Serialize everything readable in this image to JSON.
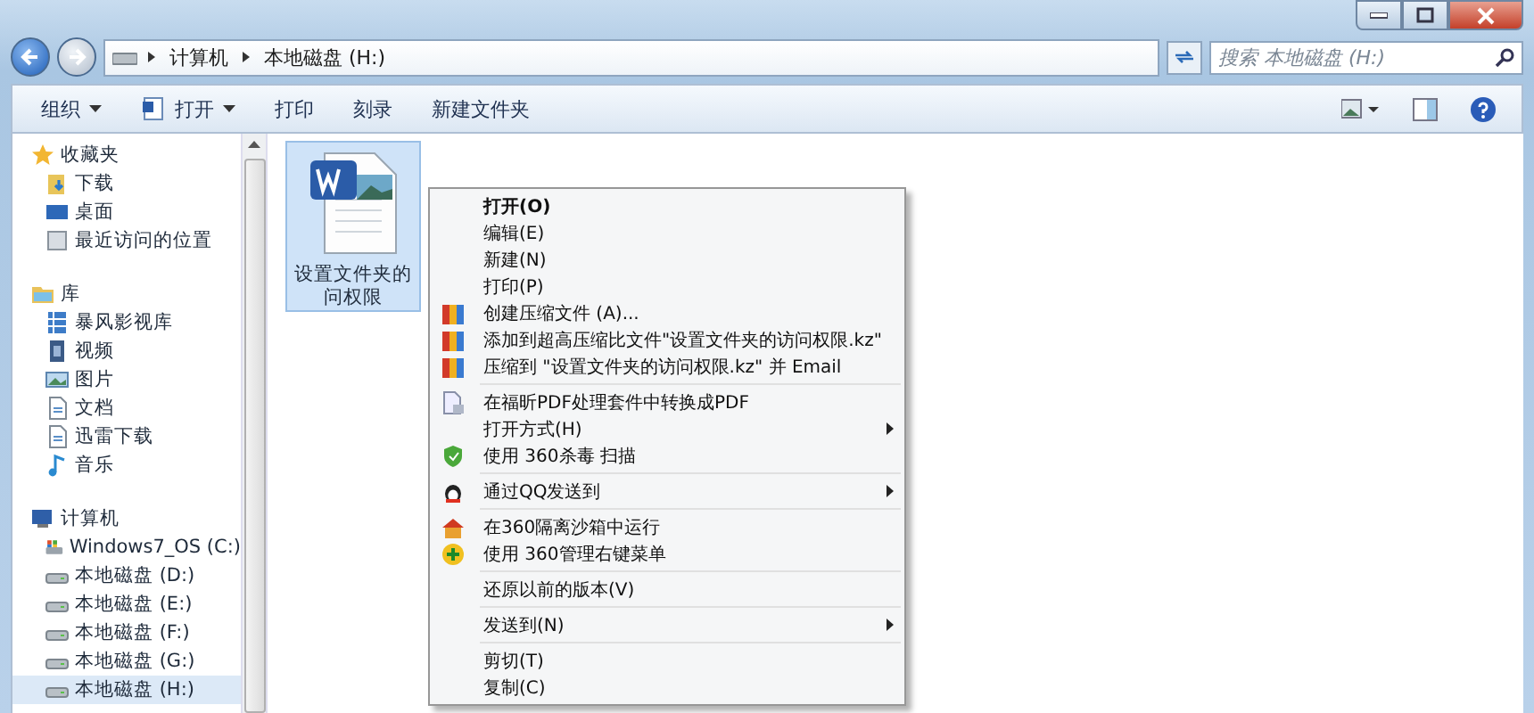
{
  "address_bar": {
    "breadcrumb": [
      "计算机",
      "本地磁盘 (H:)"
    ]
  },
  "search": {
    "placeholder": "搜索 本地磁盘 (H:)"
  },
  "toolbar": [
    {
      "label": "组织",
      "dropdown": true
    },
    {
      "label": "打开",
      "dropdown": true
    },
    {
      "label": "打印",
      "dropdown": false
    },
    {
      "label": "刻录",
      "dropdown": false
    },
    {
      "label": "新建文件夹",
      "dropdown": false
    }
  ],
  "sidebar": {
    "groups": [
      {
        "label": "收藏夹",
        "children": [
          {
            "label": "下载",
            "selected": false
          },
          {
            "label": "桌面",
            "selected": false
          },
          {
            "label": "最近访问的位置",
            "selected": false
          }
        ]
      },
      {
        "label": "库",
        "children": [
          {
            "label": "暴风影视库",
            "selected": false
          },
          {
            "label": "视频",
            "selected": false
          },
          {
            "label": "图片",
            "selected": false
          },
          {
            "label": "文档",
            "selected": false
          },
          {
            "label": "迅雷下载",
            "selected": false
          },
          {
            "label": "音乐",
            "selected": false
          }
        ]
      },
      {
        "label": "计算机",
        "children": [
          {
            "label": "Windows7_OS (C:)",
            "selected": false
          },
          {
            "label": "本地磁盘 (D:)",
            "selected": false
          },
          {
            "label": "本地磁盘 (E:)",
            "selected": false
          },
          {
            "label": "本地磁盘 (F:)",
            "selected": false
          },
          {
            "label": "本地磁盘 (G:)",
            "selected": false
          },
          {
            "label": "本地磁盘 (H:)",
            "selected": true
          }
        ]
      }
    ]
  },
  "files": [
    {
      "label_lines": [
        "设置文件夹的",
        "问权限"
      ],
      "selected": true
    }
  ],
  "context_menu": [
    {
      "kind": "item",
      "label": "打开(O)",
      "default": true,
      "submenu": false
    },
    {
      "kind": "item",
      "label": "编辑(E)",
      "default": false,
      "submenu": false
    },
    {
      "kind": "item",
      "label": "新建(N)",
      "default": false,
      "submenu": false
    },
    {
      "kind": "item",
      "label": "打印(P)",
      "default": false,
      "submenu": false
    },
    {
      "kind": "item",
      "label": "创建压缩文件 (A)...",
      "default": false,
      "submenu": false
    },
    {
      "kind": "item",
      "label": "添加到超高压缩比文件\"设置文件夹的访问权限.kz\"",
      "default": false,
      "submenu": false
    },
    {
      "kind": "item",
      "label": "压缩到 \"设置文件夹的访问权限.kz\" 并 Email",
      "default": false,
      "submenu": false
    },
    {
      "kind": "separator"
    },
    {
      "kind": "item",
      "label": "在福昕PDF处理套件中转换成PDF",
      "default": false,
      "submenu": false
    },
    {
      "kind": "item",
      "label": "打开方式(H)",
      "default": false,
      "submenu": true
    },
    {
      "kind": "item",
      "label": "使用 360杀毒 扫描",
      "default": false,
      "submenu": false
    },
    {
      "kind": "separator"
    },
    {
      "kind": "item",
      "label": "通过QQ发送到",
      "default": false,
      "submenu": true
    },
    {
      "kind": "separator"
    },
    {
      "kind": "item",
      "label": "在360隔离沙箱中运行",
      "default": false,
      "submenu": false
    },
    {
      "kind": "item",
      "label": "使用 360管理右键菜单",
      "default": false,
      "submenu": false
    },
    {
      "kind": "separator"
    },
    {
      "kind": "item",
      "label": "还原以前的版本(V)",
      "default": false,
      "submenu": false
    },
    {
      "kind": "separator"
    },
    {
      "kind": "item",
      "label": "发送到(N)",
      "default": false,
      "submenu": true
    },
    {
      "kind": "separator"
    },
    {
      "kind": "item",
      "label": "剪切(T)",
      "default": false,
      "submenu": false
    },
    {
      "kind": "item",
      "label": "复制(C)",
      "default": false,
      "submenu": false
    }
  ]
}
